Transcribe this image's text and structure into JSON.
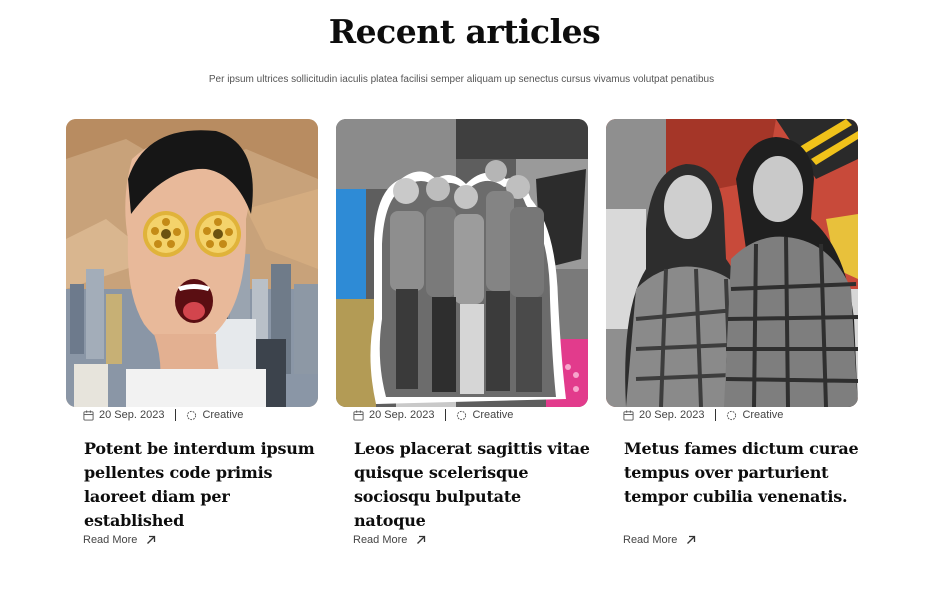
{
  "section": {
    "title": "Recent articles",
    "subtitle": "Per ipsum ultrices sollicitudin iaculis platea facilisi semper aliquam up senectus cursus vivamus volutpat penatibus"
  },
  "articles": [
    {
      "date": "20 Sep. 2023",
      "category": "Creative",
      "title": "Potent be interdum ipsum pellentes code primis laoreet diam per established",
      "read_more": "Read More",
      "image_alt": "Boy with film reels over eyes in front of city skyline"
    },
    {
      "date": "20 Sep. 2023",
      "category": "Creative",
      "title": "Leos placerat sagittis vitae quisque scelerisque sociosqu bulputate natoque",
      "read_more": "Read More",
      "image_alt": "Group of five teenagers on collage background"
    },
    {
      "date": "20 Sep. 2023",
      "category": "Creative",
      "title": "Metus fames dictum curae tempus over parturient tempor cubilia venenatis.",
      "read_more": "Read More",
      "image_alt": "Smiling couple in plaid shirts on red collage background"
    }
  ],
  "icons": {
    "date": "calendar-icon",
    "category": "category-icon",
    "read_more": "arrow-up-right-icon"
  },
  "colors": {
    "text": "#0d0d0d",
    "muted": "#555555",
    "background": "#ffffff"
  }
}
